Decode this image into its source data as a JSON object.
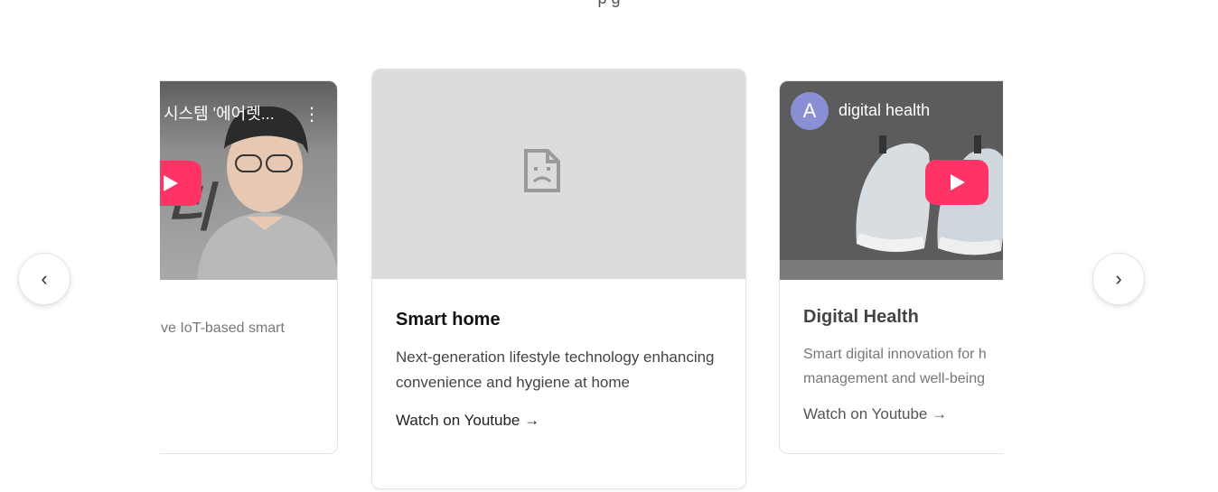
{
  "header": {
    "partial_text": "p                                    g"
  },
  "nav": {
    "prev_label": "‹",
    "next_label": "›"
  },
  "cards": [
    {
      "video_title": "시스템 '에어렛...",
      "menu_icon": "⋮",
      "title": "",
      "description": "ve IoT-based smart",
      "link": ""
    },
    {
      "title": "Smart home",
      "description": "Next-generation lifestyle technology enhancing convenience and hygiene at home",
      "link": "Watch on Youtube →"
    },
    {
      "channel_initial": "A",
      "channel_name": "digital health",
      "title": "Digital Health",
      "description": "Smart digital innovation for h management and well-being",
      "link": "Watch on Youtube →"
    }
  ],
  "colors": {
    "youtube_play": "#ff3366",
    "avatar": "#8b8fd6",
    "placeholder": "#dcdcdc"
  },
  "icons": {
    "broken_image": "broken-image-icon",
    "play": "play-icon",
    "more": "more-vert-icon"
  }
}
